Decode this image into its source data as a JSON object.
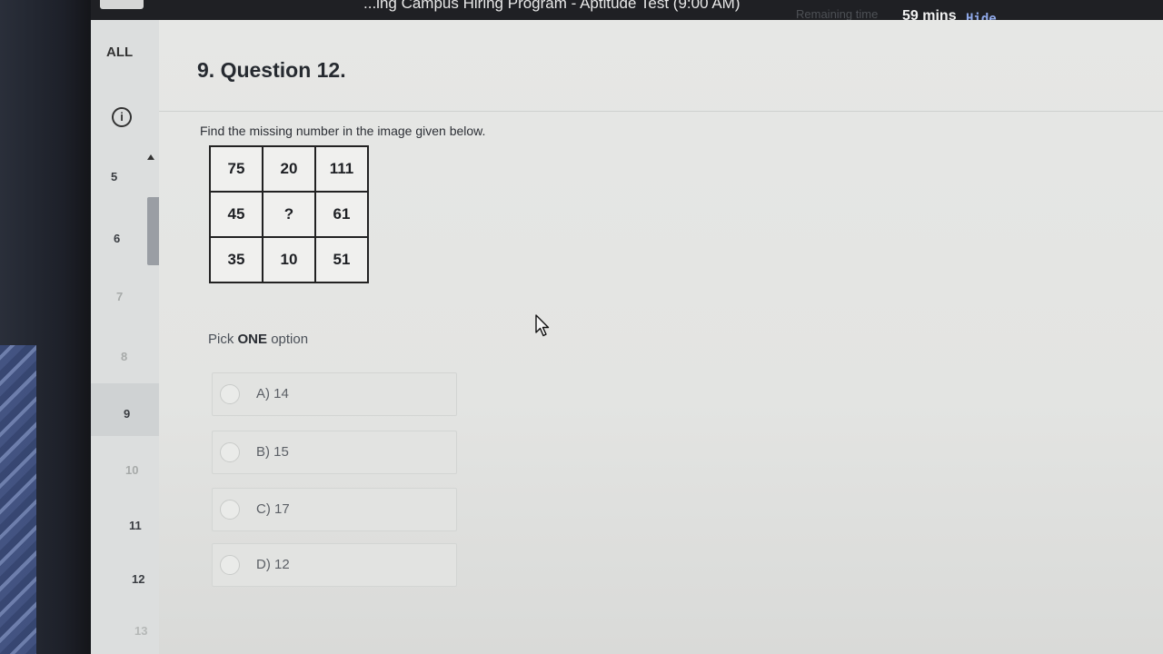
{
  "window": {
    "title": "...ing Campus Hiring Program - Aptitude Test (9:00 AM)"
  },
  "timer": {
    "label": "Remaining time",
    "value": "59 mins",
    "hide_label": "Hide"
  },
  "sidebar": {
    "all_label": "ALL",
    "info_icon": "info-icon",
    "items": [
      {
        "label": "5"
      },
      {
        "label": "6"
      },
      {
        "label": "7"
      },
      {
        "label": "8"
      },
      {
        "label": "9"
      },
      {
        "label": "10"
      },
      {
        "label": "11"
      },
      {
        "label": "12"
      },
      {
        "label": "13"
      }
    ]
  },
  "question": {
    "title": "9. Question 12.",
    "text": "Find the missing number in the image given below.",
    "grid": [
      [
        "75",
        "20",
        "111"
      ],
      [
        "45",
        "?",
        "61"
      ],
      [
        "35",
        "10",
        "51"
      ]
    ],
    "pick_prefix": "Pick ",
    "pick_bold": "ONE",
    "pick_suffix": " option",
    "options": [
      {
        "label": "A) 14"
      },
      {
        "label": "B) 15"
      },
      {
        "label": "C) 17"
      },
      {
        "label": "D) 12"
      }
    ]
  }
}
